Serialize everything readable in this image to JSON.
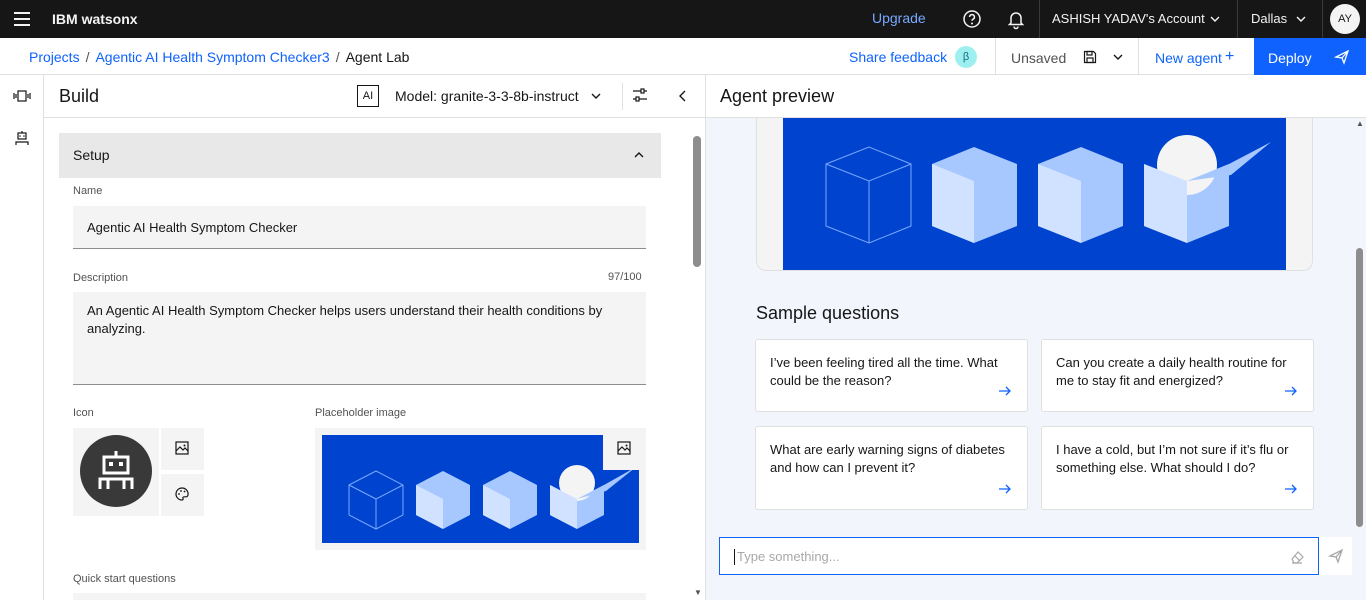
{
  "header": {
    "brand_prefix": "IBM",
    "brand_name": "watsonx",
    "upgrade_label": "Upgrade",
    "account_label": "ASHISH YADAV's Account",
    "region_label": "Dallas",
    "avatar_initials": "AY",
    "icons": [
      "menu-icon",
      "help-icon",
      "notification-icon",
      "chevron-down-icon"
    ]
  },
  "breadcrumb": {
    "items": [
      "Projects",
      "Agentic AI Health Symptom Checker3",
      "Agent Lab"
    ],
    "separator": "/"
  },
  "toolbar": {
    "share_feedback_label": "Share feedback",
    "beta_badge": "β",
    "status_label": "Unsaved",
    "new_agent_label": "New agent",
    "new_agent_plus": "+",
    "deploy_label": "Deploy"
  },
  "build": {
    "title": "Build",
    "ai_badge": "AI",
    "model_label": "Model: granite-3-3-8b-instruct",
    "setup": {
      "title": "Setup",
      "name_label": "Name",
      "name_value": "Agentic AI Health Symptom Checker",
      "description_label": "Description",
      "description_counter": "97/100",
      "description_value": "An Agentic AI Health Symptom Checker helps users understand their health conditions by analyzing.",
      "icon_label": "Icon",
      "placeholder_image_label": "Placeholder image",
      "quick_start_label": "Quick start questions"
    }
  },
  "preview": {
    "title": "Agent preview",
    "sample_questions_title": "Sample questions",
    "sample_questions": [
      "I’ve been feeling tired all the time. What could be the reason?",
      "Can you create a daily health routine for me to stay fit and energized?",
      "What are early warning signs of diabetes and how can I prevent it?",
      "I have a cold, but I’m not sure if it’s flu or something else. What should I do?"
    ],
    "input_placeholder": "Type something..."
  },
  "colors": {
    "accent": "#0f62fe",
    "header_bg": "#161616",
    "hero_blue": "#0043ce",
    "preview_bg": "#f2f5fc"
  }
}
